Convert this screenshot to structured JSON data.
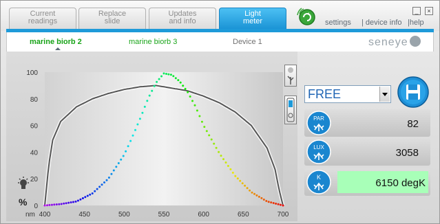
{
  "tabs": [
    {
      "line1": "Current",
      "line2": "readings",
      "active": false
    },
    {
      "line1": "Replace",
      "line2": "slide",
      "active": false
    },
    {
      "line1": "Updates",
      "line2": "and info",
      "active": false
    },
    {
      "line1": "Light",
      "line2": "meter",
      "active": true
    }
  ],
  "header_links": {
    "settings": "settings",
    "device_info": "| device info",
    "help": "|help"
  },
  "window_buttons": {
    "minimize": "_",
    "close": "×"
  },
  "devices": [
    {
      "name": "marine biorb 2",
      "selected": true
    },
    {
      "name": "marine biorb 3",
      "selected": false
    },
    {
      "name": "Device 1",
      "selected": false
    }
  ],
  "logo_text": "seneye",
  "chart_data": {
    "type": "line",
    "xlabel": "nm",
    "ylabel": "%",
    "x_ticks": [
      400,
      450,
      500,
      550,
      600,
      650,
      700
    ],
    "y_ticks": [
      0,
      20,
      40,
      60,
      80,
      100
    ],
    "xlim": [
      400,
      700
    ],
    "ylim": [
      0,
      100
    ],
    "series": [
      {
        "style": "rainbow-dotted",
        "x": [
          400,
          420,
          440,
          460,
          480,
          500,
          510,
          520,
          530,
          540,
          550,
          560,
          570,
          580,
          590,
          600,
          620,
          640,
          660,
          680,
          700
        ],
        "y": [
          0,
          1,
          3,
          9,
          20,
          38,
          51,
          65,
          80,
          92,
          99,
          98,
          93,
          85,
          74,
          60,
          39,
          22,
          10,
          3,
          0
        ]
      },
      {
        "style": "grey-solid",
        "x": [
          400,
          405,
          410,
          420,
          440,
          460,
          480,
          500,
          520,
          540,
          550,
          560,
          580,
          600,
          620,
          640,
          660,
          680,
          690,
          695,
          700
        ],
        "y": [
          0,
          30,
          49,
          63,
          74,
          80,
          84,
          87,
          89,
          90,
          89,
          88,
          86,
          82,
          77,
          70,
          60,
          43,
          27,
          12,
          0
        ]
      }
    ]
  },
  "profile": {
    "selected": "FREE"
  },
  "measurements": [
    {
      "label": "PAR",
      "value": "82",
      "highlight": false
    },
    {
      "label": "LUX",
      "value": "3058",
      "highlight": false
    },
    {
      "label": "K",
      "value": "6150 degK",
      "highlight": true
    }
  ],
  "colors": {
    "accent": "#1e9ad9",
    "selected_device": "#17a317",
    "k_highlight": "#a8ffb8"
  }
}
